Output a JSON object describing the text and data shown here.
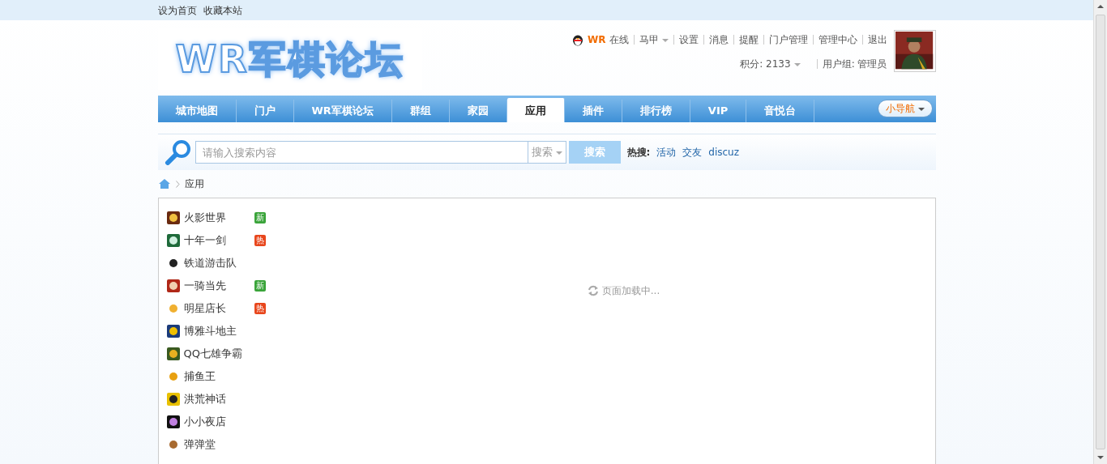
{
  "topbar": {
    "links": [
      "设为首页",
      "收藏本站"
    ]
  },
  "logo": {
    "text": "WR军棋论坛"
  },
  "user": {
    "name": "WR",
    "status": "在线",
    "menu": [
      {
        "label": "马甲",
        "dropdown": true
      },
      {
        "label": "设置",
        "dropdown": false
      },
      {
        "label": "消息",
        "dropdown": false
      },
      {
        "label": "提醒",
        "dropdown": false
      },
      {
        "label": "门户管理",
        "dropdown": false
      },
      {
        "label": "管理中心",
        "dropdown": false
      },
      {
        "label": "退出",
        "dropdown": false
      }
    ],
    "credits": "积分: 2133",
    "group": "用户组: 管理员"
  },
  "nav": {
    "items": [
      {
        "label": "城市地图",
        "selected": false
      },
      {
        "label": "门户",
        "selected": false
      },
      {
        "label": "WR军棋论坛",
        "selected": false
      },
      {
        "label": "群组",
        "selected": false
      },
      {
        "label": "家园",
        "selected": false
      },
      {
        "label": "应用",
        "selected": true
      },
      {
        "label": "插件",
        "selected": false
      },
      {
        "label": "排行榜",
        "selected": false
      },
      {
        "label": "VIP",
        "selected": false
      },
      {
        "label": "音悦台",
        "selected": false
      }
    ],
    "quick_nav": "小导航"
  },
  "search": {
    "placeholder": "请输入搜索内容",
    "scope": "搜索",
    "button": "搜索",
    "hot_label": "热搜:",
    "hot": [
      "活动",
      "交友",
      "discuz"
    ]
  },
  "breadcrumb": [
    "应用"
  ],
  "apps": [
    {
      "name": "火影世界",
      "tag": {
        "kind": "new",
        "text": "新"
      }
    },
    {
      "name": "十年一剑",
      "tag": {
        "kind": "hot",
        "text": "热"
      }
    },
    {
      "name": "铁道游击队"
    },
    {
      "name": "一骑当先",
      "tag": {
        "kind": "new",
        "text": "新"
      }
    },
    {
      "name": "明星店长",
      "tag": {
        "kind": "hot",
        "text": "热"
      }
    },
    {
      "name": "博雅斗地主"
    },
    {
      "name": "QQ七雄争霸"
    },
    {
      "name": "捕鱼王"
    },
    {
      "name": "洪荒神话"
    },
    {
      "name": "小小夜店"
    },
    {
      "name": "弹弹堂"
    }
  ],
  "loading": "页面加载中..."
}
